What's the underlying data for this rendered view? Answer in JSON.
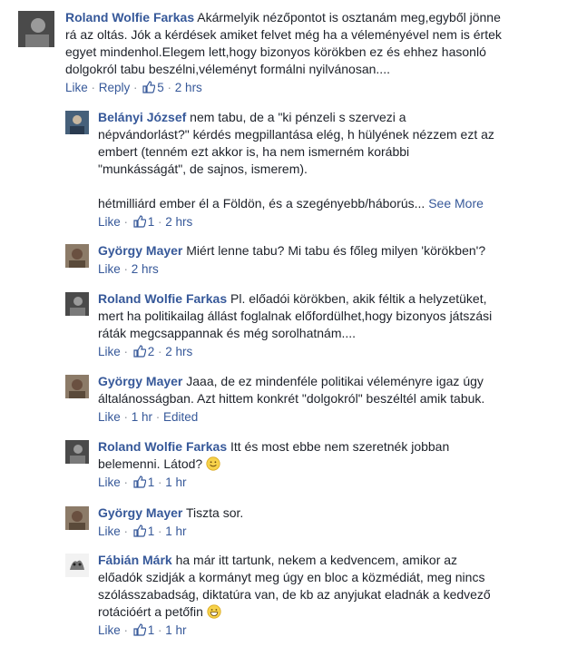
{
  "comments": [
    {
      "author": "Roland Wolfie Farkas",
      "text": "Akármelyik nézőpontot is osztanám meg,egyből jönne\nrá az oltás. Jók a kérdések amiket felvet még ha a véleményével nem is értek\negyet mindenhol.Elegem lett,hogy bizonyos körökben ez és ehhez hasonló\ndolgokról tabu beszélni,véleményt formálni nyilvánosan....",
      "like": "Like",
      "reply": "Reply",
      "likes": "5",
      "time": "2 hrs",
      "icon": "avatar-photo-icon"
    },
    {
      "author": "Belányi József",
      "text": "nem tabu, de a \"ki pénzeli s szervezi a\nnépvándorlást?\" kérdés megpillantása elég, h hülyének nézzem ezt az\nembert (tenném ezt akkor is, ha nem ismerném korábbi\n\"munkásságát\", de sajnos, ismerem).\n\nhétmilliárd ember él a Földön, és a szegényebb/háborús...",
      "see_more": "See More",
      "like": "Like",
      "likes": "1",
      "time": "2 hrs",
      "icon": "avatar-photo-icon"
    },
    {
      "author": "György Mayer",
      "text": "Miért lenne tabu? Mi tabu és főleg milyen 'körökben'?",
      "like": "Like",
      "time": "2 hrs",
      "icon": "avatar-photo-icon"
    },
    {
      "author": "Roland Wolfie Farkas",
      "text": "Pl. előadói körökben, akik féltik a helyzetüket,\nmert ha politikailag állást foglalnak előfordülhet,hogy bizonyos játszási\nráták megcsappannak és még sorolhatnám....",
      "like": "Like",
      "likes": "2",
      "time": "2 hrs",
      "icon": "avatar-photo-icon"
    },
    {
      "author": "György Mayer",
      "text": "Jaaa, de ez mindenféle politikai véleményre igaz úgy\náltalánosságban. Azt hittem konkrét \"dolgokról\" beszéltél amik tabuk.",
      "like": "Like",
      "time": "1 hr",
      "edited": "Edited",
      "icon": "avatar-photo-icon"
    },
    {
      "author": "Roland Wolfie Farkas",
      "text": "Itt és most ebbe nem szeretnék jobban\nbelemenni. Látod?",
      "emoji": "smile-emoji-icon",
      "like": "Like",
      "likes": "1",
      "time": "1 hr",
      "icon": "avatar-photo-icon"
    },
    {
      "author": "György Mayer",
      "text": "Tiszta sor.",
      "like": "Like",
      "likes": "1",
      "time": "1 hr",
      "icon": "avatar-photo-icon"
    },
    {
      "author": "Fábián Márk",
      "text": "ha már itt tartunk, nekem a kedvencem, amikor az\nelőadók szidják a kormányt meg úgy en bloc a közmédiát, meg nincs\nszólásszabadság, diktatúra van, de kb az anyjukat eladnák a kedvező\nrotációért a petőfin",
      "emoji": "grin-emoji-icon",
      "like": "Like",
      "likes": "1",
      "time": "1 hr",
      "icon": "avatar-photo-icon"
    }
  ],
  "colors": {
    "link": "#365899",
    "meta": "#90949c",
    "text": "#1d2129"
  }
}
